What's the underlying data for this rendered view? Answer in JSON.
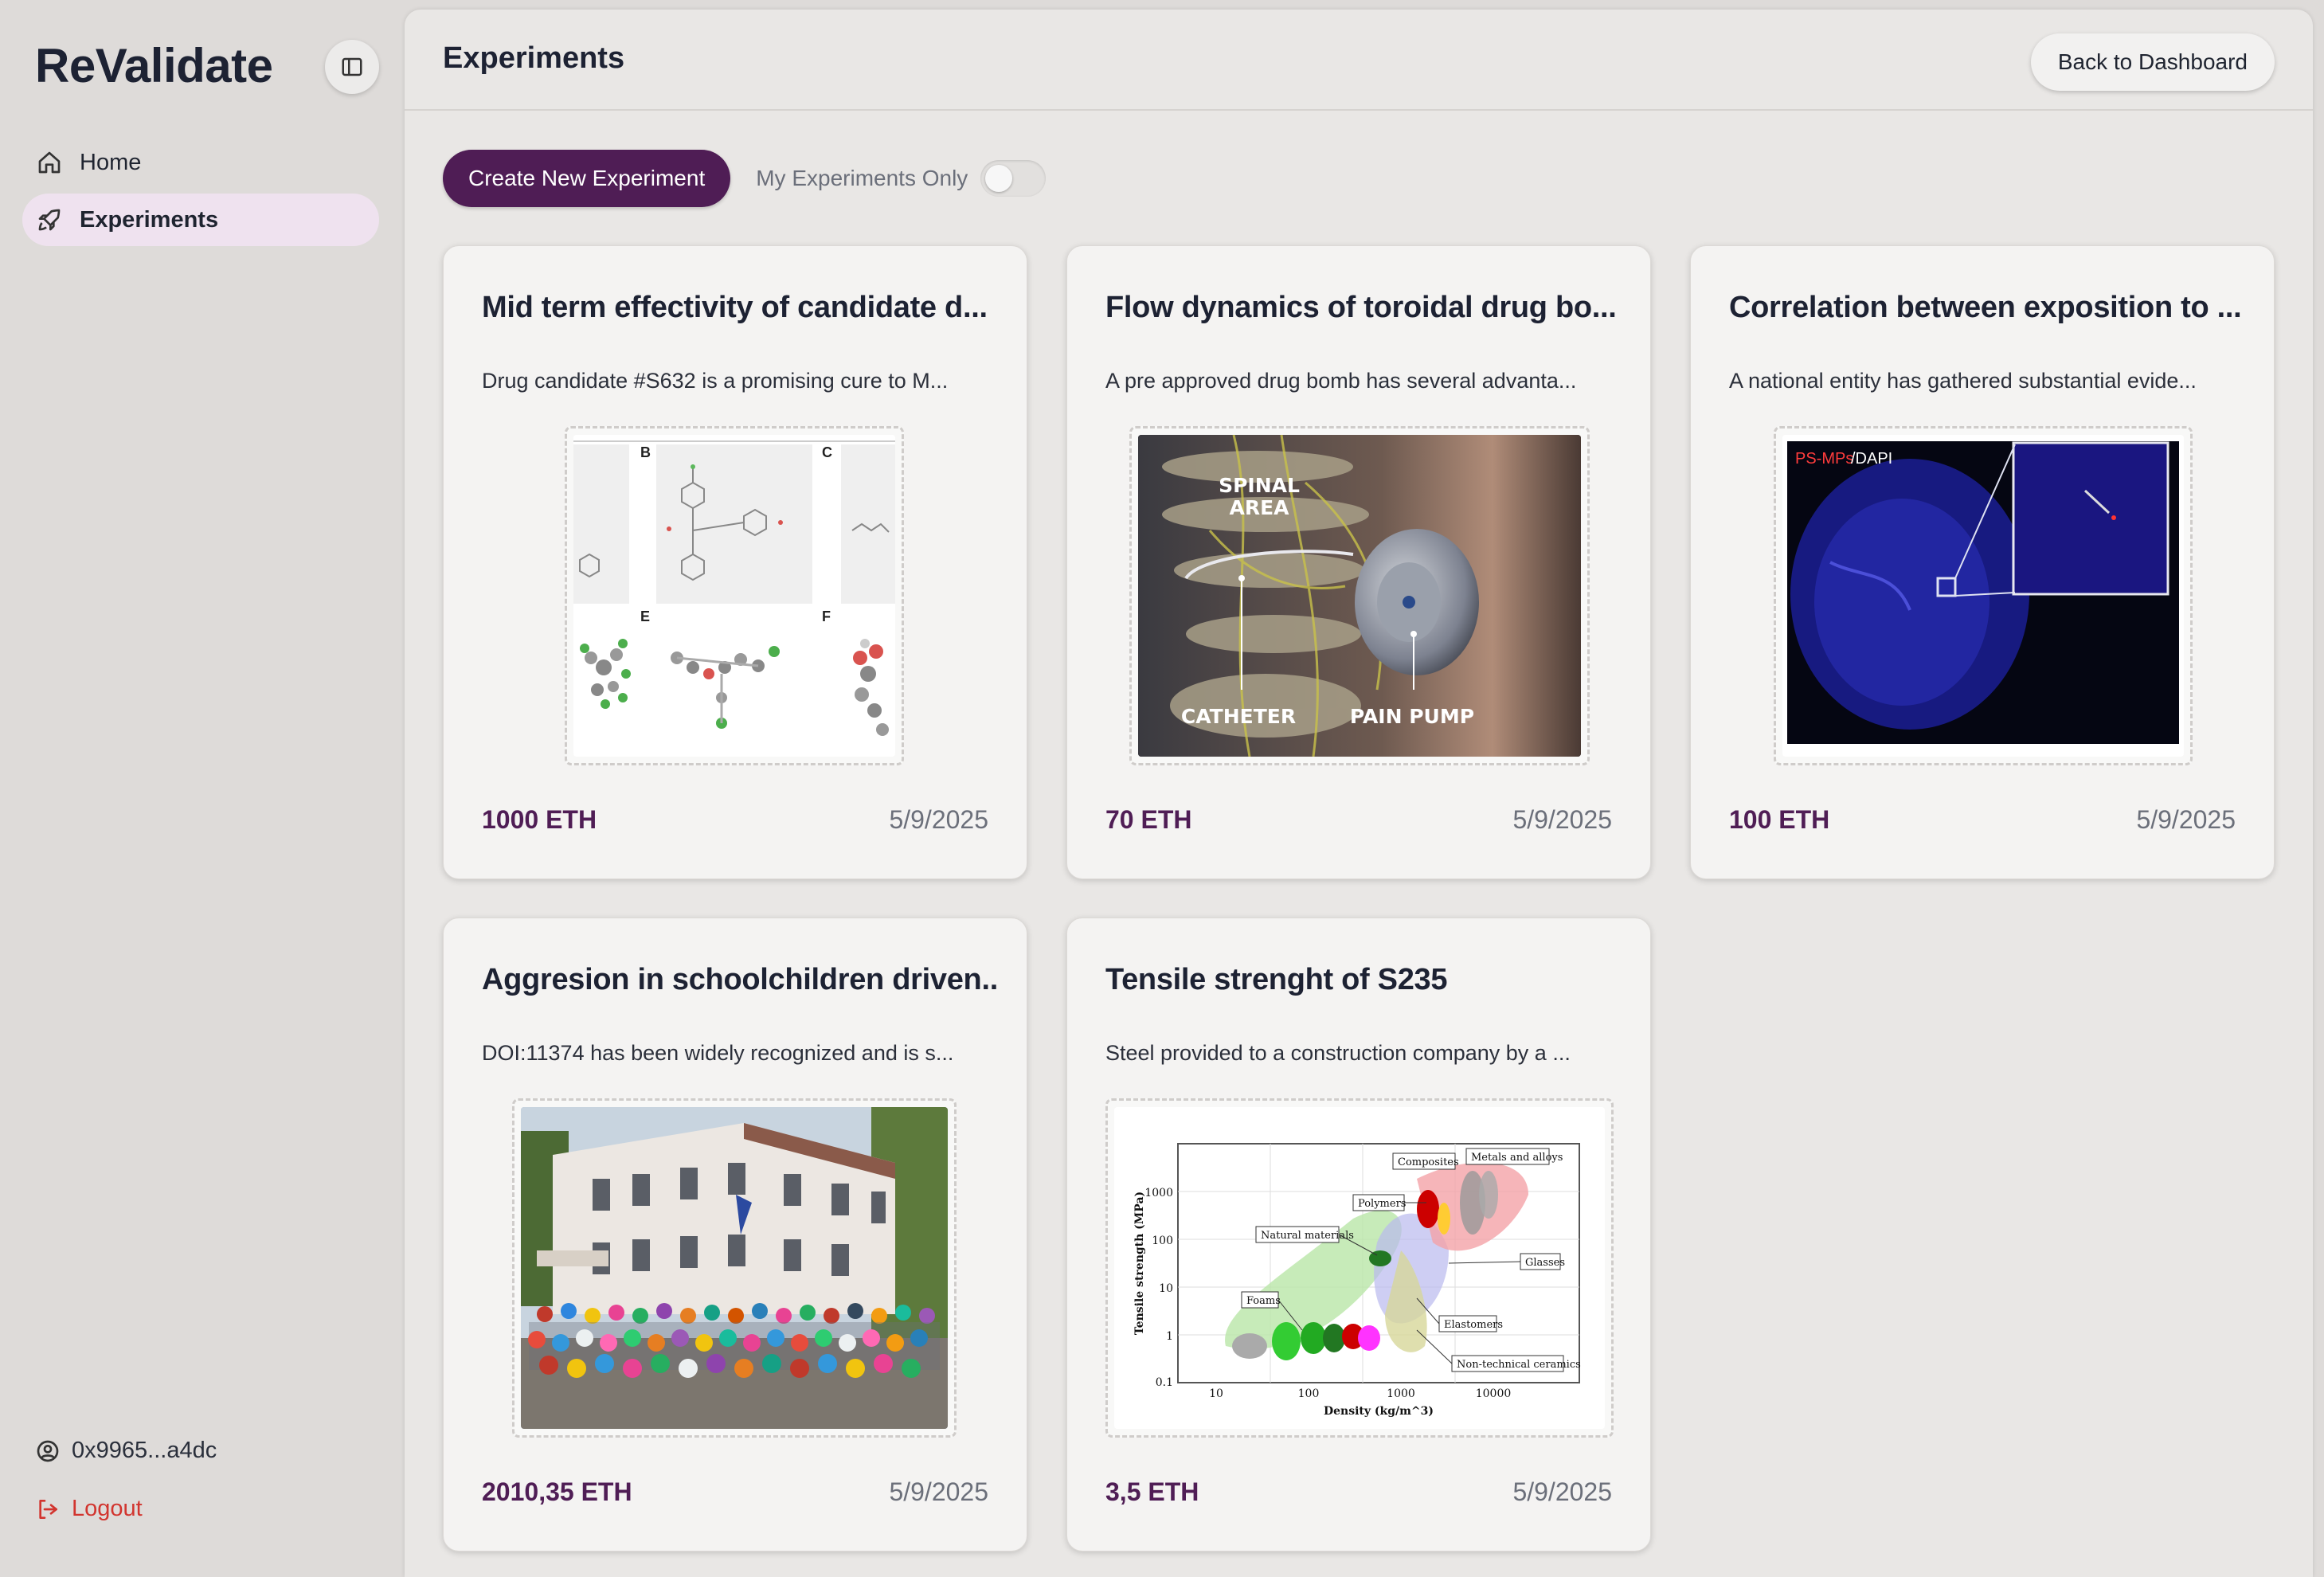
{
  "app": {
    "name": "ReValidate"
  },
  "sidebar": {
    "items": [
      {
        "label": "Home",
        "icon": "home-icon"
      },
      {
        "label": "Experiments",
        "icon": "rocket-icon",
        "active": true
      }
    ],
    "account": {
      "address": "0x9965...a4dc",
      "icon": "user-circle-icon"
    },
    "logout": {
      "label": "Logout",
      "icon": "logout-icon",
      "color": "#d2352f"
    }
  },
  "header": {
    "title": "Experiments",
    "back_label": "Back to Dashboard"
  },
  "toolbar": {
    "create_label": "Create New Experiment",
    "filter_label": "My Experiments Only",
    "filter_on": false
  },
  "colors": {
    "accent": "#4f1d55",
    "active_nav": "#efe2ef",
    "danger": "#d2352f"
  },
  "experiments": [
    {
      "title": "Mid term effectivity of candidate d...",
      "description": "Drug candidate #S632 is a promising cure to M...",
      "price": "1000 ETH",
      "date": "5/9/2025",
      "image": "molecule-structures"
    },
    {
      "title": "Flow dynamics of toroidal drug bo...",
      "description": "A pre approved drug bomb has several advanta...",
      "price": "70 ETH",
      "date": "5/9/2025",
      "image": "spinal-pain-pump",
      "image_labels": [
        "SPINAL AREA",
        "CATHETER",
        "PAIN PUMP"
      ]
    },
    {
      "title": "Correlation between exposition to ...",
      "description": "A national entity has gathered substantial evide...",
      "price": "100 ETH",
      "date": "5/9/2025",
      "image": "fluorescence-microscopy",
      "image_labels": [
        "PS-MPs",
        "/DAPI"
      ]
    },
    {
      "title": "Aggresion in schoolchildren driven...",
      "description": "DOI:11374 has been widely recognized and is s...",
      "price": "2010,35 ETH",
      "date": "5/9/2025",
      "image": "school-group-photo"
    },
    {
      "title": "Tensile strenght of S235",
      "description": "Steel provided to a construction company by a ...",
      "price": "3,5 ETH",
      "date": "5/9/2025",
      "image": "ashby-chart",
      "image_labels": {
        "ylabel": "Tensile strength (MPa)",
        "xlabel": "Density (kg/m^3)",
        "groups": [
          "Composites",
          "Metals and alloys",
          "Polymers",
          "Natural materials",
          "Glasses",
          "Foams",
          "Elastomers",
          "Non-technical ceramics"
        ],
        "yticks": [
          "1000",
          "100",
          "10",
          "1",
          "0.1"
        ],
        "xticks": [
          "10",
          "100",
          "1000",
          "10000"
        ]
      }
    }
  ]
}
